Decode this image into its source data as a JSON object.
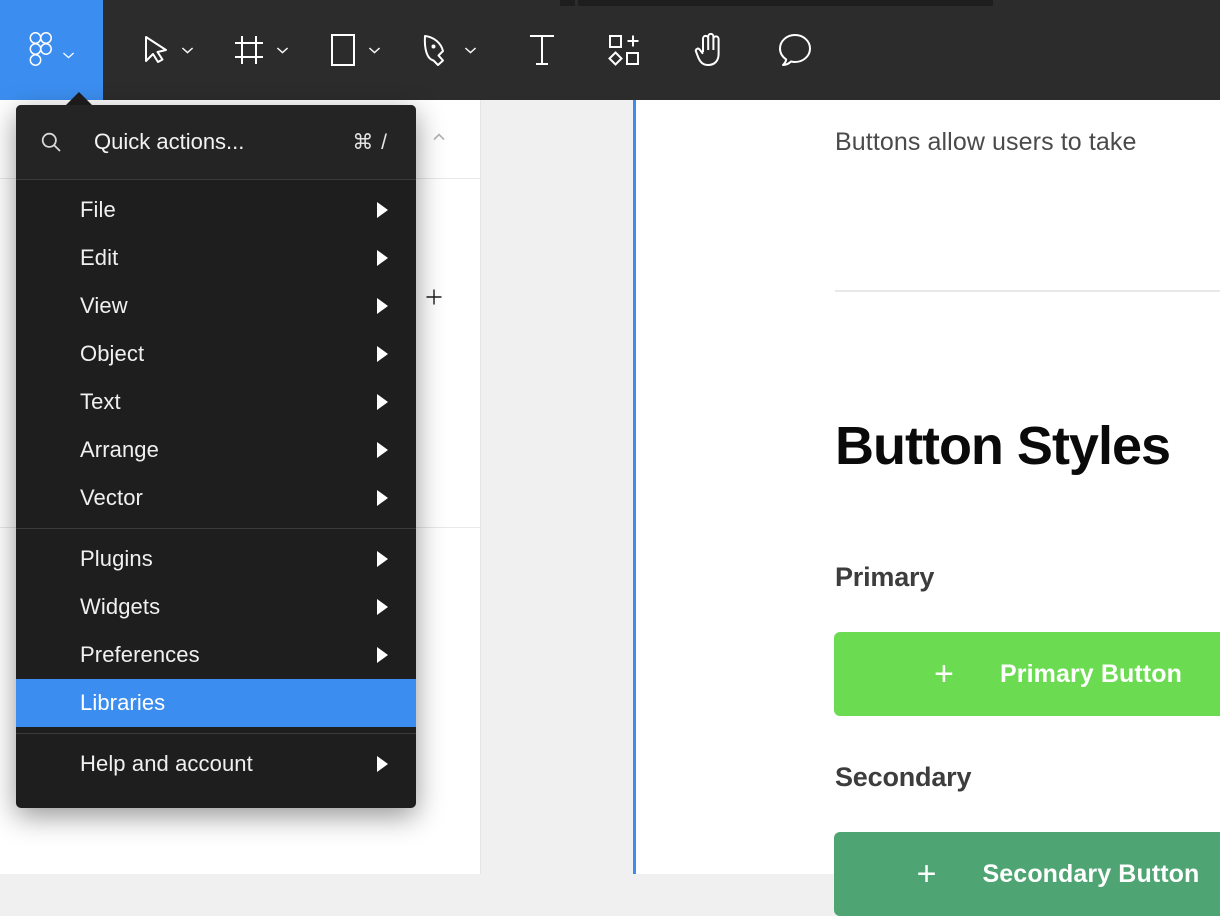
{
  "app": {
    "name": "Figma",
    "accent_blue": "#3b8ef0",
    "toolbar_bg": "#2c2c2c",
    "menu_bg": "#1e1e1e"
  },
  "toolbar": {
    "logo": {
      "icon": "figma-logo-icon",
      "caret": "chevron-down-icon"
    },
    "tools": [
      {
        "name": "move-tool",
        "icon": "cursor-arrow-icon",
        "has_caret": true
      },
      {
        "name": "frame-tool",
        "icon": "frame-icon",
        "has_caret": true
      },
      {
        "name": "shape-tool",
        "icon": "rectangle-icon",
        "has_caret": true
      },
      {
        "name": "pen-tool",
        "icon": "pen-icon",
        "has_caret": true
      },
      {
        "name": "text-tool",
        "icon": "text-t-icon",
        "has_caret": false
      },
      {
        "name": "actions-tool",
        "icon": "components-actions-icon",
        "has_caret": false
      },
      {
        "name": "hand-tool",
        "icon": "hand-icon",
        "has_caret": false
      },
      {
        "name": "comment-tool",
        "icon": "comment-bubble-icon",
        "has_caret": false
      }
    ]
  },
  "menu": {
    "search": {
      "icon": "search-icon",
      "placeholder": "Quick actions...",
      "shortcut": "⌘ /"
    },
    "groups": [
      {
        "items": [
          {
            "label": "File",
            "submenu": true
          },
          {
            "label": "Edit",
            "submenu": true
          },
          {
            "label": "View",
            "submenu": true
          },
          {
            "label": "Object",
            "submenu": true
          },
          {
            "label": "Text",
            "submenu": true
          },
          {
            "label": "Arrange",
            "submenu": true
          },
          {
            "label": "Vector",
            "submenu": true
          }
        ]
      },
      {
        "items": [
          {
            "label": "Plugins",
            "submenu": true,
            "selected": false
          },
          {
            "label": "Widgets",
            "submenu": true,
            "selected": false
          },
          {
            "label": "Preferences",
            "submenu": true,
            "selected": false
          },
          {
            "label": "Libraries",
            "submenu": false,
            "selected": true
          }
        ]
      },
      {
        "items": [
          {
            "label": "Help and account",
            "submenu": true
          }
        ]
      }
    ]
  },
  "left_panel": {
    "collapse_icon": "chevron-up-icon",
    "add_icon": "plus-icon"
  },
  "canvas": {
    "frame": {
      "description": "Buttons allow users to take",
      "title": "Button Styles",
      "groups": [
        {
          "label": "Primary",
          "button": {
            "text": "Primary Button",
            "leading_icon": "plus-icon",
            "trailing_icon": "arrow-right-icon",
            "color": "#6bdc51"
          }
        },
        {
          "label": "Secondary",
          "button": {
            "text": "Secondary Button",
            "leading_icon": "plus-icon",
            "trailing_icon": "arrow-right-icon",
            "color": "#4fa473"
          }
        }
      ]
    }
  }
}
